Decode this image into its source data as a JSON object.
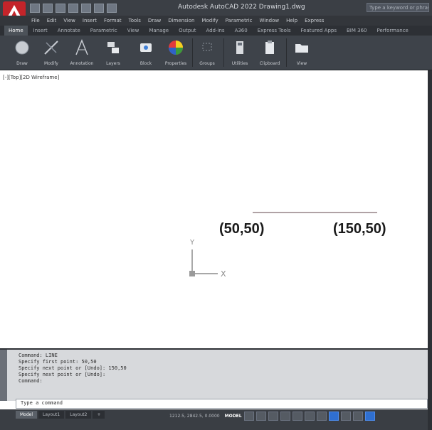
{
  "window": {
    "title": "Autodesk AutoCAD 2022  Drawing1.dwg",
    "search_placeholder": "Type a keyword or phrase"
  },
  "menu": [
    "File",
    "Edit",
    "View",
    "Insert",
    "Format",
    "Tools",
    "Draw",
    "Dimension",
    "Modify",
    "Parametric",
    "Window",
    "Help",
    "Express"
  ],
  "ribbon_tabs": [
    {
      "label": "Home",
      "active": true
    },
    {
      "label": "Insert"
    },
    {
      "label": "Annotate"
    },
    {
      "label": "Parametric"
    },
    {
      "label": "View"
    },
    {
      "label": "Manage"
    },
    {
      "label": "Output"
    },
    {
      "label": "Add-ins"
    },
    {
      "label": "A360"
    },
    {
      "label": "Express Tools"
    },
    {
      "label": "Featured Apps"
    },
    {
      "label": "BIM 360"
    },
    {
      "label": "Performance"
    }
  ],
  "ribbon_buttons": [
    {
      "label": "Draw",
      "icon": "draw-icon"
    },
    {
      "label": "Modify",
      "icon": "modify-icon"
    },
    {
      "label": "Annotation",
      "icon": "annotation-icon"
    },
    {
      "label": "Layers",
      "icon": "layers-icon"
    },
    {
      "label": "Block",
      "icon": "block-icon"
    },
    {
      "label": "Properties",
      "icon": "properties-icon"
    },
    {
      "label": "Groups",
      "icon": "groups-icon"
    },
    {
      "label": "Utilities",
      "icon": "utilities-icon"
    },
    {
      "label": "Clipboard",
      "icon": "clipboard-icon"
    },
    {
      "label": "View",
      "icon": "view-folder-icon"
    }
  ],
  "viewport_label": "[-][Top][2D Wireframe]",
  "drawing": {
    "start_label": "(50,50)",
    "end_label": "(150,50)",
    "ucs_x": "X",
    "ucs_y": "Y"
  },
  "command_history": [
    "Command: LINE",
    "Specify first point: 50,50",
    "Specify next point or [Undo]: 150,50",
    "Specify next point or [Undo]:",
    "Command:"
  ],
  "command_prompt": "Type a command",
  "layout_tabs": [
    {
      "label": "Model",
      "active": true
    },
    {
      "label": "Layout1"
    },
    {
      "label": "Layout2"
    },
    {
      "label": "+"
    }
  ],
  "status": {
    "coords": "1212.5, 2842.5, 0.0000",
    "mode": "MODEL"
  },
  "colors": {
    "app_button": "#c4242a",
    "title_bar": "#3b3f45",
    "ribbon": "#3e434a",
    "line": "#b0a2a5"
  }
}
